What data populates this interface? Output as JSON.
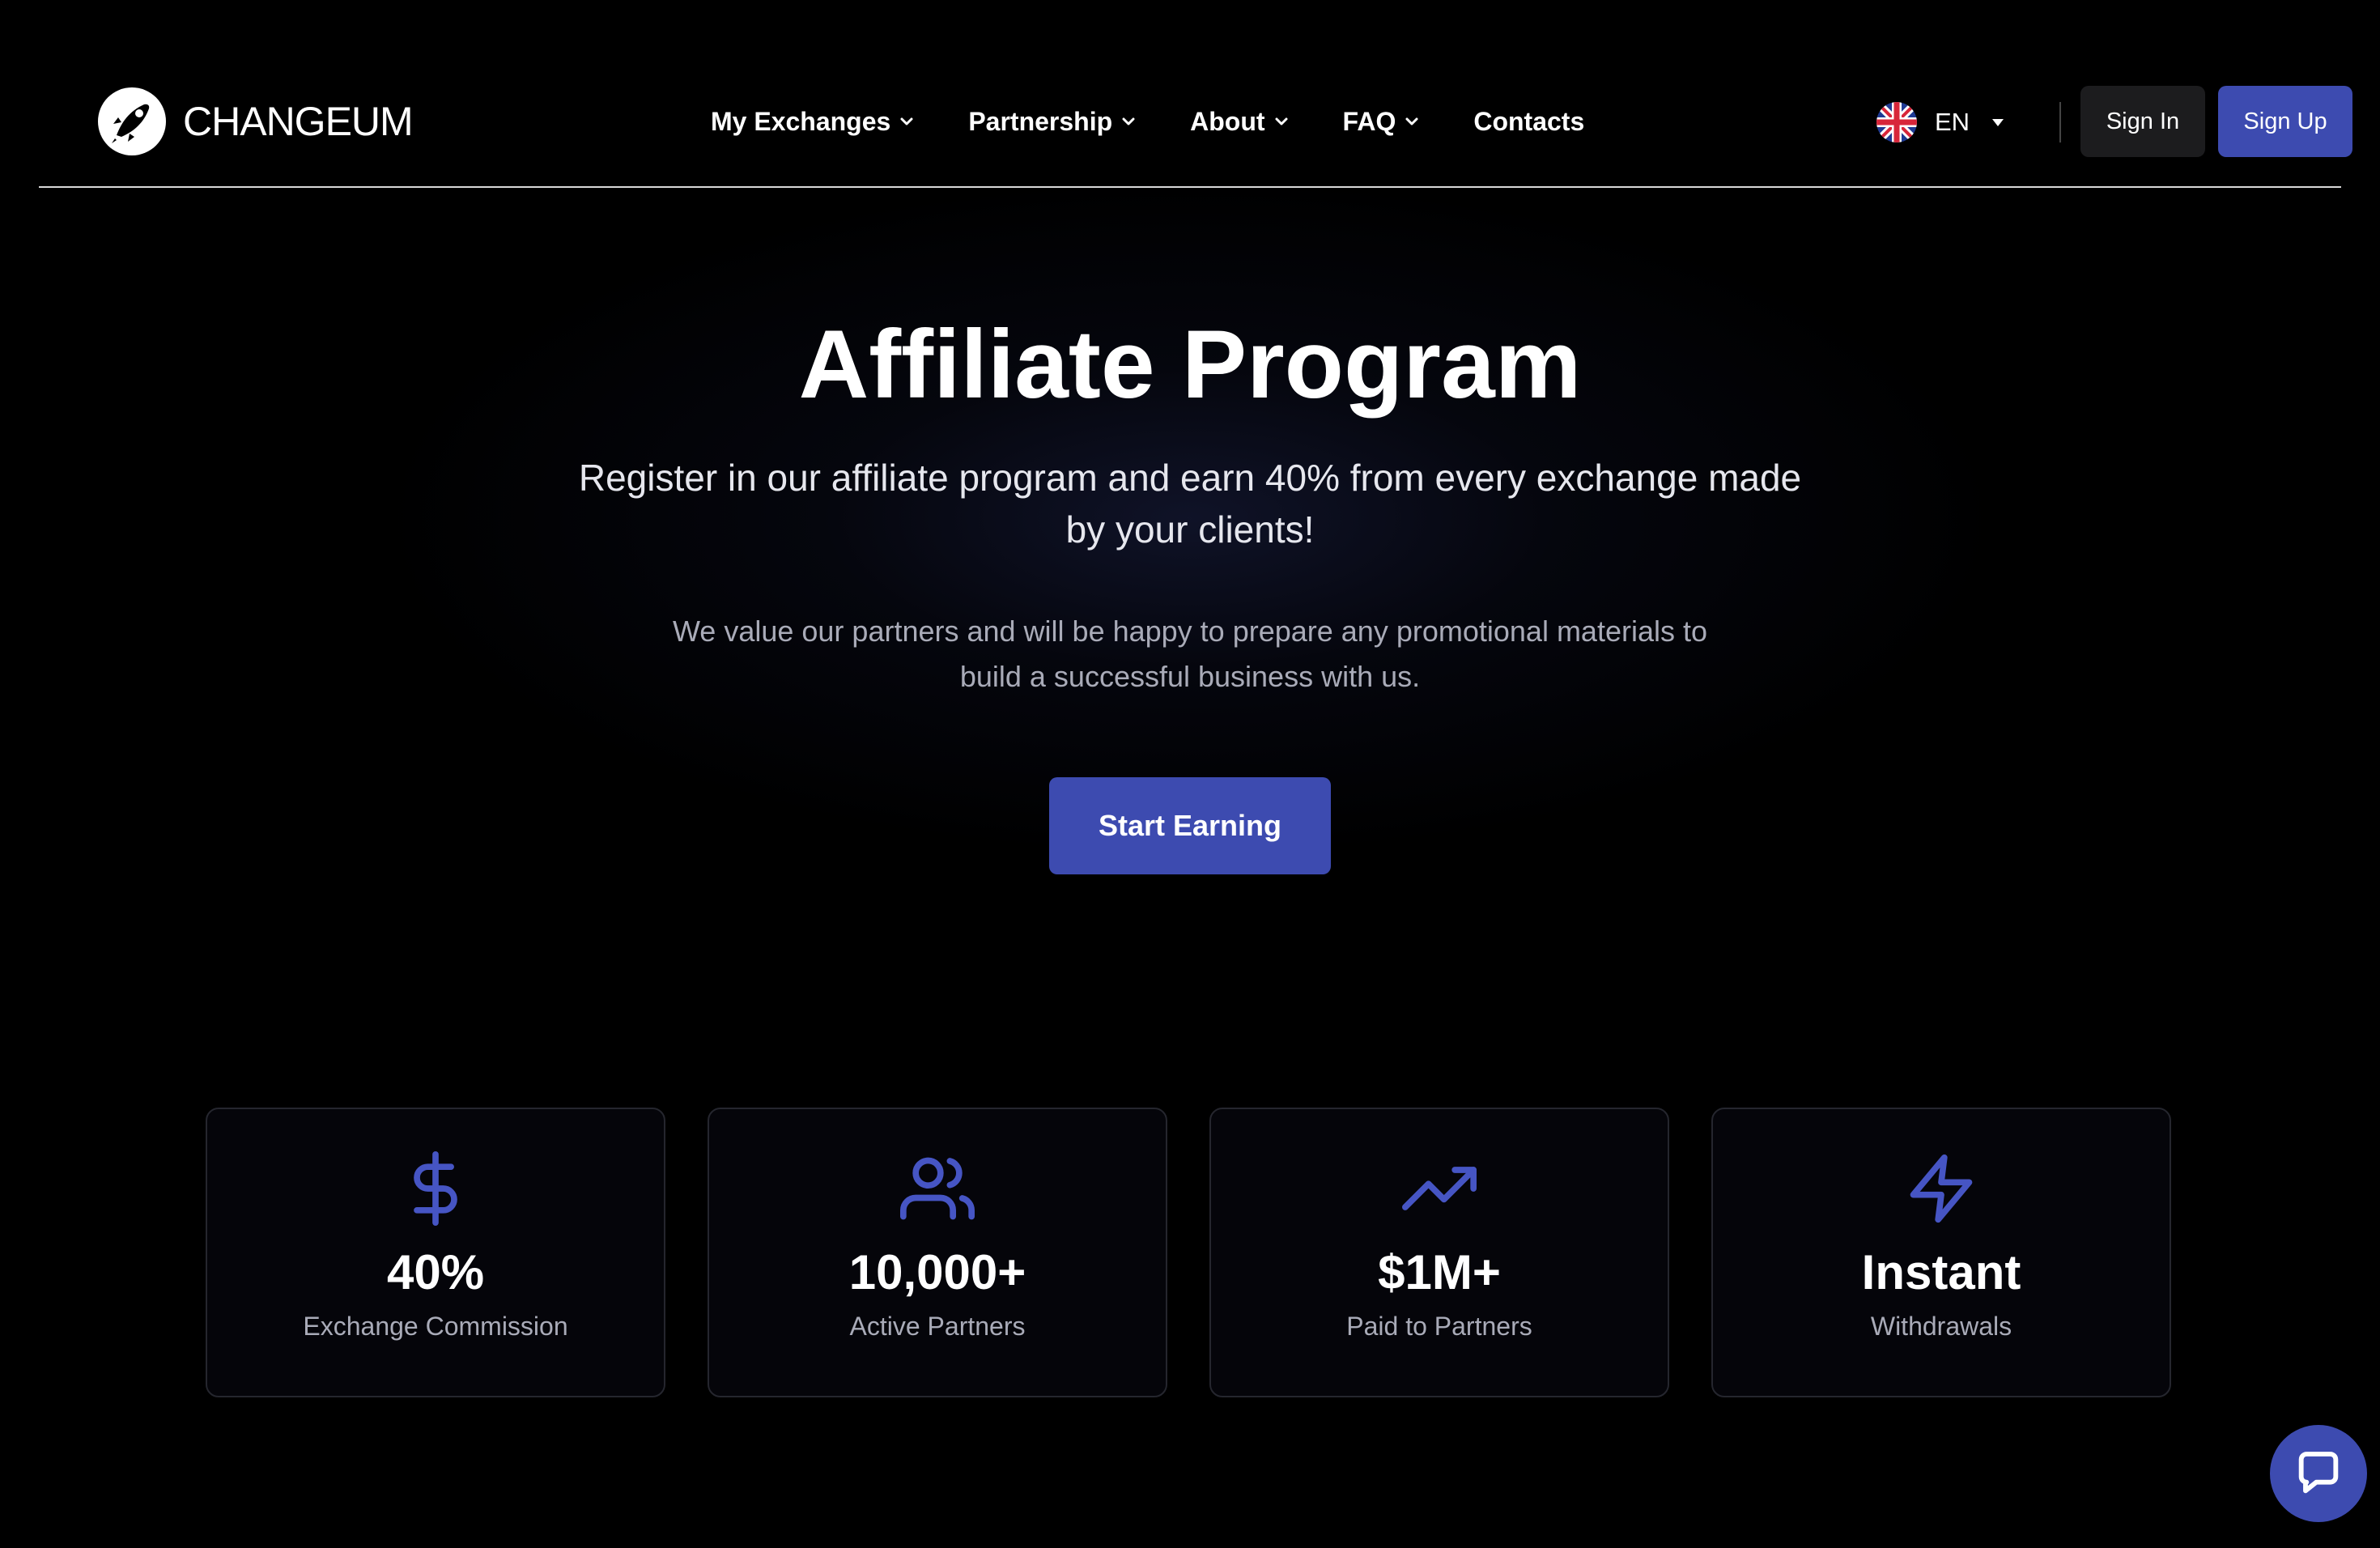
{
  "brand": {
    "name": "CHANGEUM",
    "logo_icon": "rocket-logo-icon"
  },
  "nav": {
    "items": [
      {
        "label": "My Exchanges",
        "has_dropdown": true
      },
      {
        "label": "Partnership",
        "has_dropdown": true
      },
      {
        "label": "About",
        "has_dropdown": true
      },
      {
        "label": "FAQ",
        "has_dropdown": true
      },
      {
        "label": "Contacts",
        "has_dropdown": false
      }
    ]
  },
  "language": {
    "code": "EN",
    "flag_icon": "uk-flag-icon"
  },
  "auth": {
    "sign_in": "Sign In",
    "sign_up": "Sign Up"
  },
  "hero": {
    "title": "Affiliate Program",
    "subtitle": "Register in our affiliate program and earn 40% from every exchange made by your clients!",
    "description": "We value our partners and will be happy to prepare any promotional materials to build a successful business with us.",
    "cta": "Start Earning"
  },
  "stats": [
    {
      "icon": "dollar-icon",
      "value": "40%",
      "label": "Exchange Commission"
    },
    {
      "icon": "users-icon",
      "value": "10,000+",
      "label": "Active Partners"
    },
    {
      "icon": "trending-up-icon",
      "value": "$1M+",
      "label": "Paid to Partners"
    },
    {
      "icon": "lightning-icon",
      "value": "Instant",
      "label": "Withdrawals"
    }
  ],
  "chat": {
    "icon": "chat-icon"
  },
  "colors": {
    "background": "#000000",
    "accent": "#3d4bb0",
    "icon_accent": "#4655c4",
    "muted_text": "#a9abb8",
    "card_border": "#25262e"
  }
}
